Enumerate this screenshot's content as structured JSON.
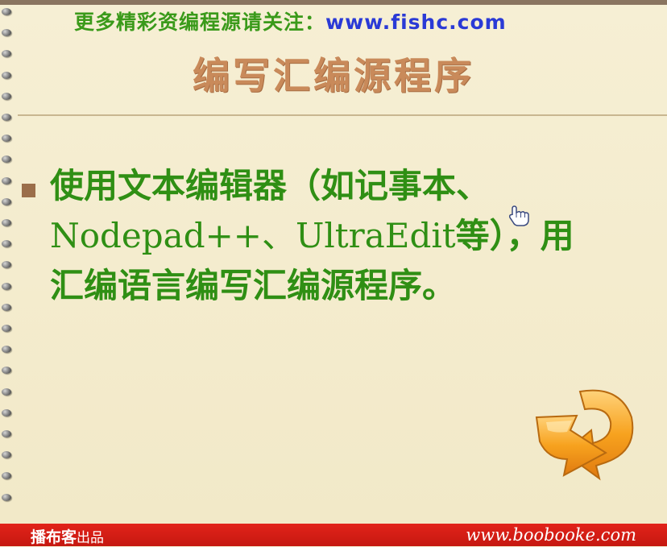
{
  "banner": {
    "promo_text": "更多精彩资编程源请关注：",
    "url": "www.fishc.com"
  },
  "slide": {
    "title": "编写汇编源程序",
    "bullet": {
      "line1": "使用文本编辑器（如记事本、",
      "line2_latin": "Nodepad++、UltraEdit",
      "line2_cn": "等），用",
      "line3": "汇编语言编写汇编源程序。"
    },
    "next_button": {
      "icon": "curved-arrow-icon",
      "color": "#f5a623"
    }
  },
  "footer": {
    "brand": "播布客",
    "brand_suffix": "出品",
    "url": "www.boobooke.com",
    "background": "#e2231a"
  },
  "colors": {
    "paper": "#f4ecce",
    "title": "#c98a5a",
    "body_text": "#2f8f14",
    "bullet": "#9b6e4a"
  }
}
